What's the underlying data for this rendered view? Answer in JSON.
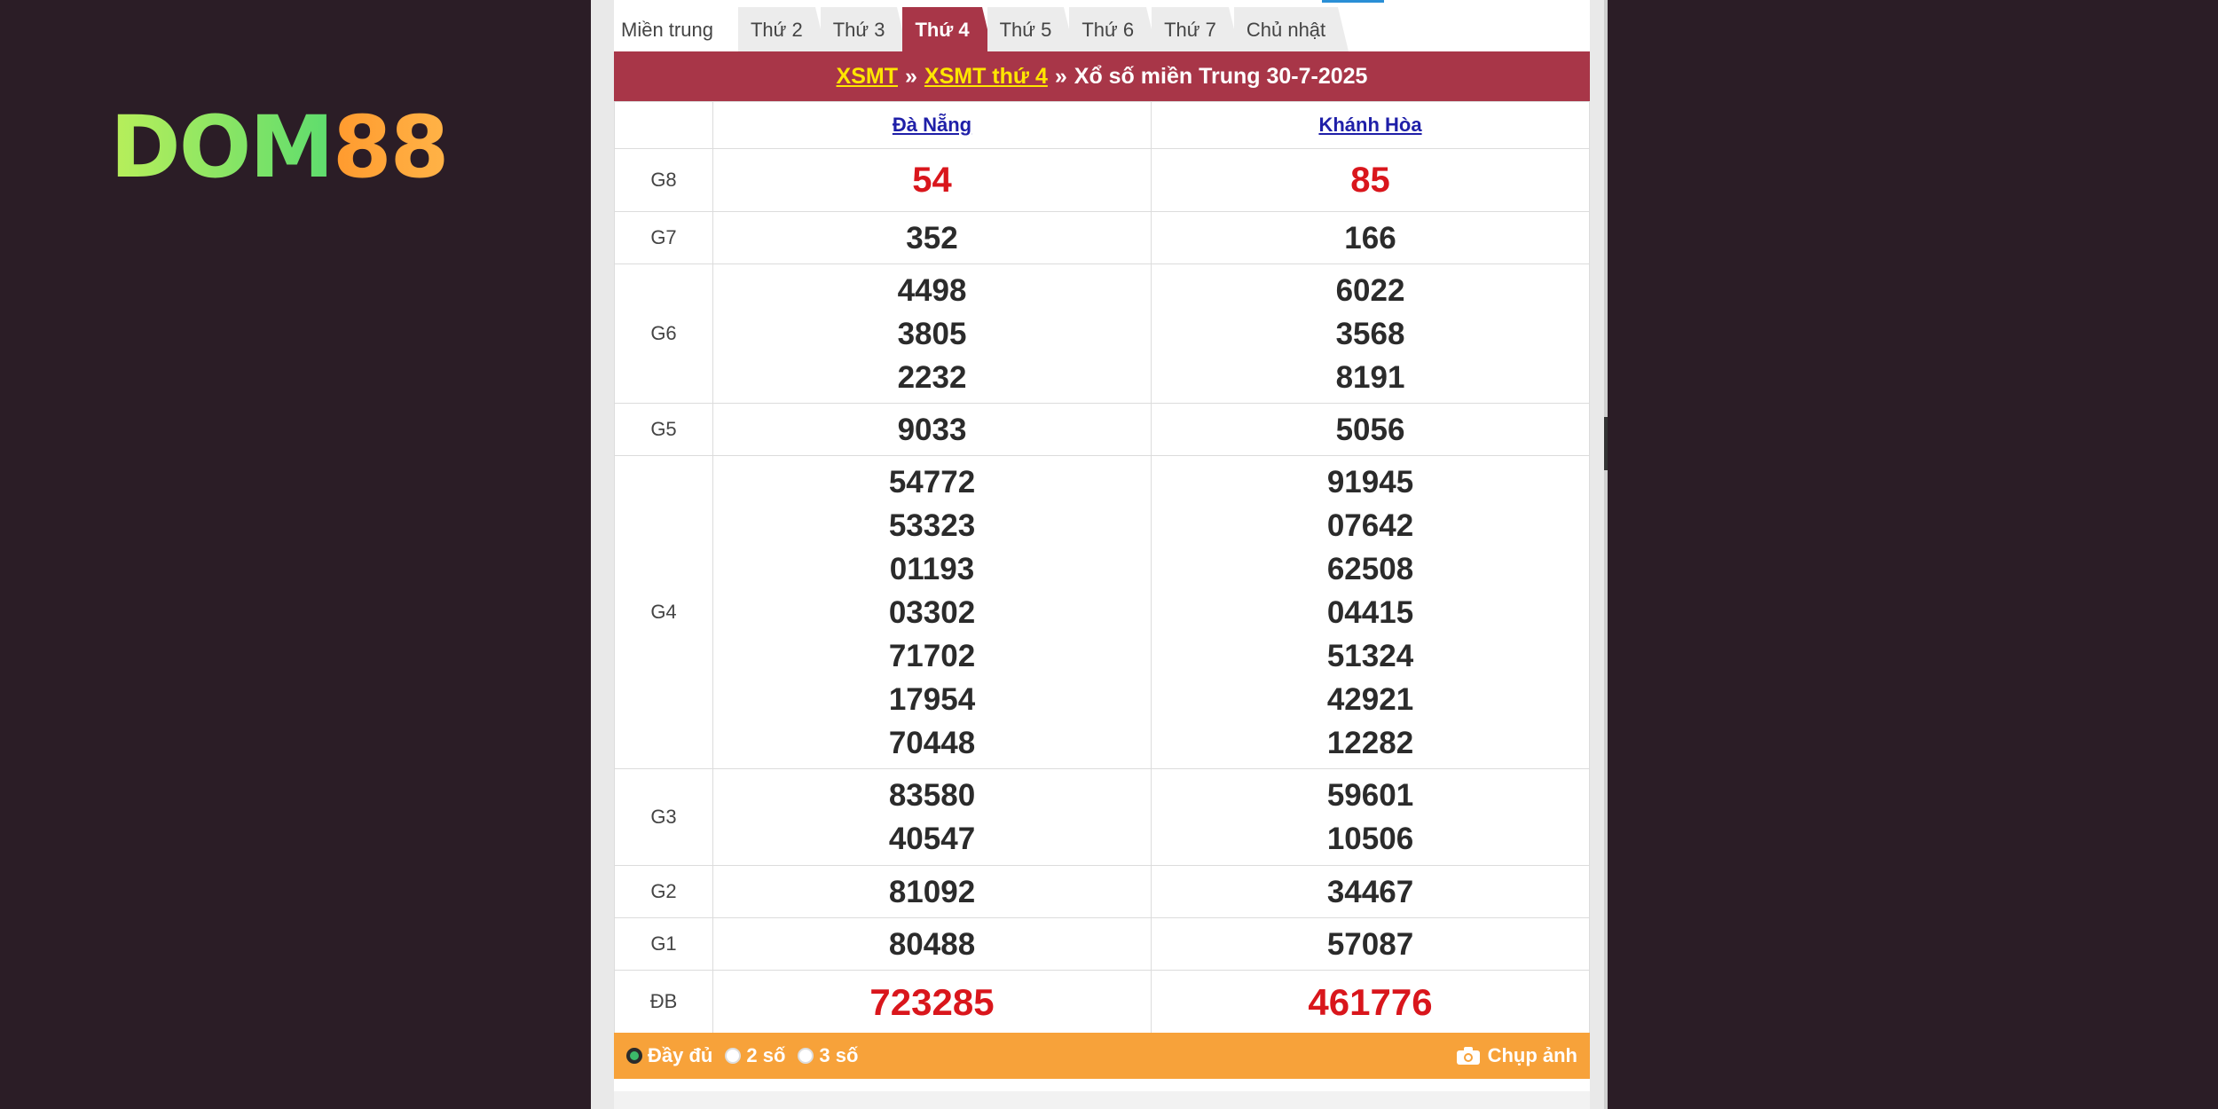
{
  "logo": {
    "part1": "DOM",
    "part2": "88"
  },
  "tabs": [
    {
      "label": "Miền trung"
    },
    {
      "label": "Thứ 2"
    },
    {
      "label": "Thứ 3"
    },
    {
      "label": "Thứ 4"
    },
    {
      "label": "Thứ 5"
    },
    {
      "label": "Thứ 6"
    },
    {
      "label": "Thứ 7"
    },
    {
      "label": "Chủ nhật"
    }
  ],
  "active_tab": "Thứ 4",
  "header": {
    "link1": "XSMT",
    "sep": "»",
    "link2": "XSMT thứ 4",
    "text": "Xổ số miền Trung 30-7-2025"
  },
  "provinces": [
    "Đà Nẵng",
    "Khánh Hòa"
  ],
  "prizes": [
    {
      "label": "G8",
      "a": [
        "54"
      ],
      "b": [
        "85"
      ]
    },
    {
      "label": "G7",
      "a": [
        "352"
      ],
      "b": [
        "166"
      ]
    },
    {
      "label": "G6",
      "a": [
        "4498",
        "3805",
        "2232"
      ],
      "b": [
        "6022",
        "3568",
        "8191"
      ]
    },
    {
      "label": "G5",
      "a": [
        "9033"
      ],
      "b": [
        "5056"
      ]
    },
    {
      "label": "G4",
      "a": [
        "54772",
        "53323",
        "01193",
        "03302",
        "71702",
        "17954",
        "70448"
      ],
      "b": [
        "91945",
        "07642",
        "62508",
        "04415",
        "51324",
        "42921",
        "12282"
      ]
    },
    {
      "label": "G3",
      "a": [
        "83580",
        "40547"
      ],
      "b": [
        "59601",
        "10506"
      ]
    },
    {
      "label": "G2",
      "a": [
        "81092"
      ],
      "b": [
        "34467"
      ]
    },
    {
      "label": "G1",
      "a": [
        "80488"
      ],
      "b": [
        "57087"
      ]
    },
    {
      "label": "ĐB",
      "a": [
        "723285"
      ],
      "b": [
        "461776"
      ]
    }
  ],
  "footer": {
    "options": [
      "Đầy đủ",
      "2 số",
      "3 số"
    ],
    "selected": "Đầy đủ",
    "snapshot": "Chụp ảnh"
  },
  "colors": {
    "brand_red": "#a83648",
    "footer_orange": "#f7a23a",
    "prize_red": "#d9161c",
    "link_yellow": "#ffe600",
    "background": "#2b1d26"
  }
}
